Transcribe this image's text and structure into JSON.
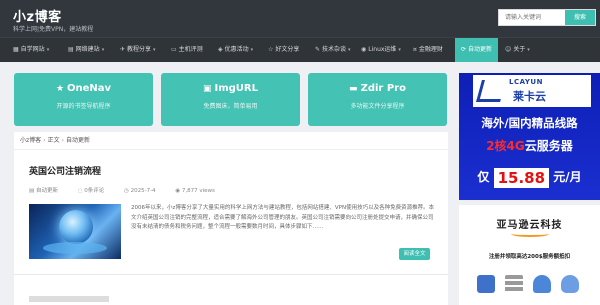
{
  "header": {
    "title": "小z博客",
    "subtitle": "科学上网|免费VPN，建站教程",
    "search_placeholder": "请输入关键词",
    "search_button": "搜索"
  },
  "nav": {
    "items": [
      {
        "label": "自学网站",
        "icon": "grid-icon",
        "caret": true
      },
      {
        "label": "网络建站",
        "icon": "server-icon",
        "caret": true
      },
      {
        "label": "教程分享",
        "icon": "plane-icon",
        "caret": true
      },
      {
        "label": "主机评测",
        "icon": "monitor-icon",
        "caret": false
      },
      {
        "label": "优惠活动",
        "icon": "tag-icon",
        "caret": true
      },
      {
        "label": "好文分享",
        "icon": "star-icon",
        "caret": false
      },
      {
        "label": "技术杂谈",
        "icon": "pencil-icon",
        "caret": true
      },
      {
        "label": "Linux运维",
        "icon": "linux-icon",
        "caret": true
      },
      {
        "label": "金融理财",
        "icon": "coin-icon",
        "caret": false
      },
      {
        "label": "自动更新",
        "icon": "refresh-icon",
        "caret": false,
        "active": true
      },
      {
        "label": "关于",
        "icon": "user-icon",
        "caret": true
      }
    ]
  },
  "cards": [
    {
      "title": "OneNav",
      "icon": "star-icon",
      "desc": "开源的书签导航程序"
    },
    {
      "title": "ImgURL",
      "icon": "image-icon",
      "desc": "免费图床，简单易用"
    },
    {
      "title": "Zdir Pro",
      "icon": "folder-icon",
      "desc": "多功能文件分享程序"
    }
  ],
  "breadcrumb": {
    "home": "小z博客",
    "sep": "›",
    "section": "正文",
    "current": "自动更新"
  },
  "article": {
    "title": "英国公司注销流程",
    "category": "自动更新",
    "comments": "0条评论",
    "date": "2025-7-4",
    "views": "7,877 views",
    "excerpt": "2006年以来，小z博客分享了大量实用的科学上网方法与建站教程，包括网站搭建、VPN使用技巧以及各种免费资源推荐。本文介绍英国公司注销的完整流程，适合需要了解海外公司管理的朋友。英国公司注销需要向公司注册处提交申请，并确保公司没有未结清的债务和税务问题，整个流程一般需要数月时间，具体步骤如下……",
    "read_more": "阅读全文"
  },
  "ad1": {
    "brand_en": "LCAYUN",
    "brand_cn": "莱卡云",
    "line1": "海外/国内精品线路",
    "line2_red": "2核4G",
    "line2": "云服务器",
    "line3_prefix": "仅",
    "price": "15.88",
    "line3_suffix": "元/月",
    "brand_color": "#1b2fd1"
  },
  "ad2": {
    "title": "亚马逊云科技",
    "desc": "注册并领取高达200$服务额抵扣"
  }
}
